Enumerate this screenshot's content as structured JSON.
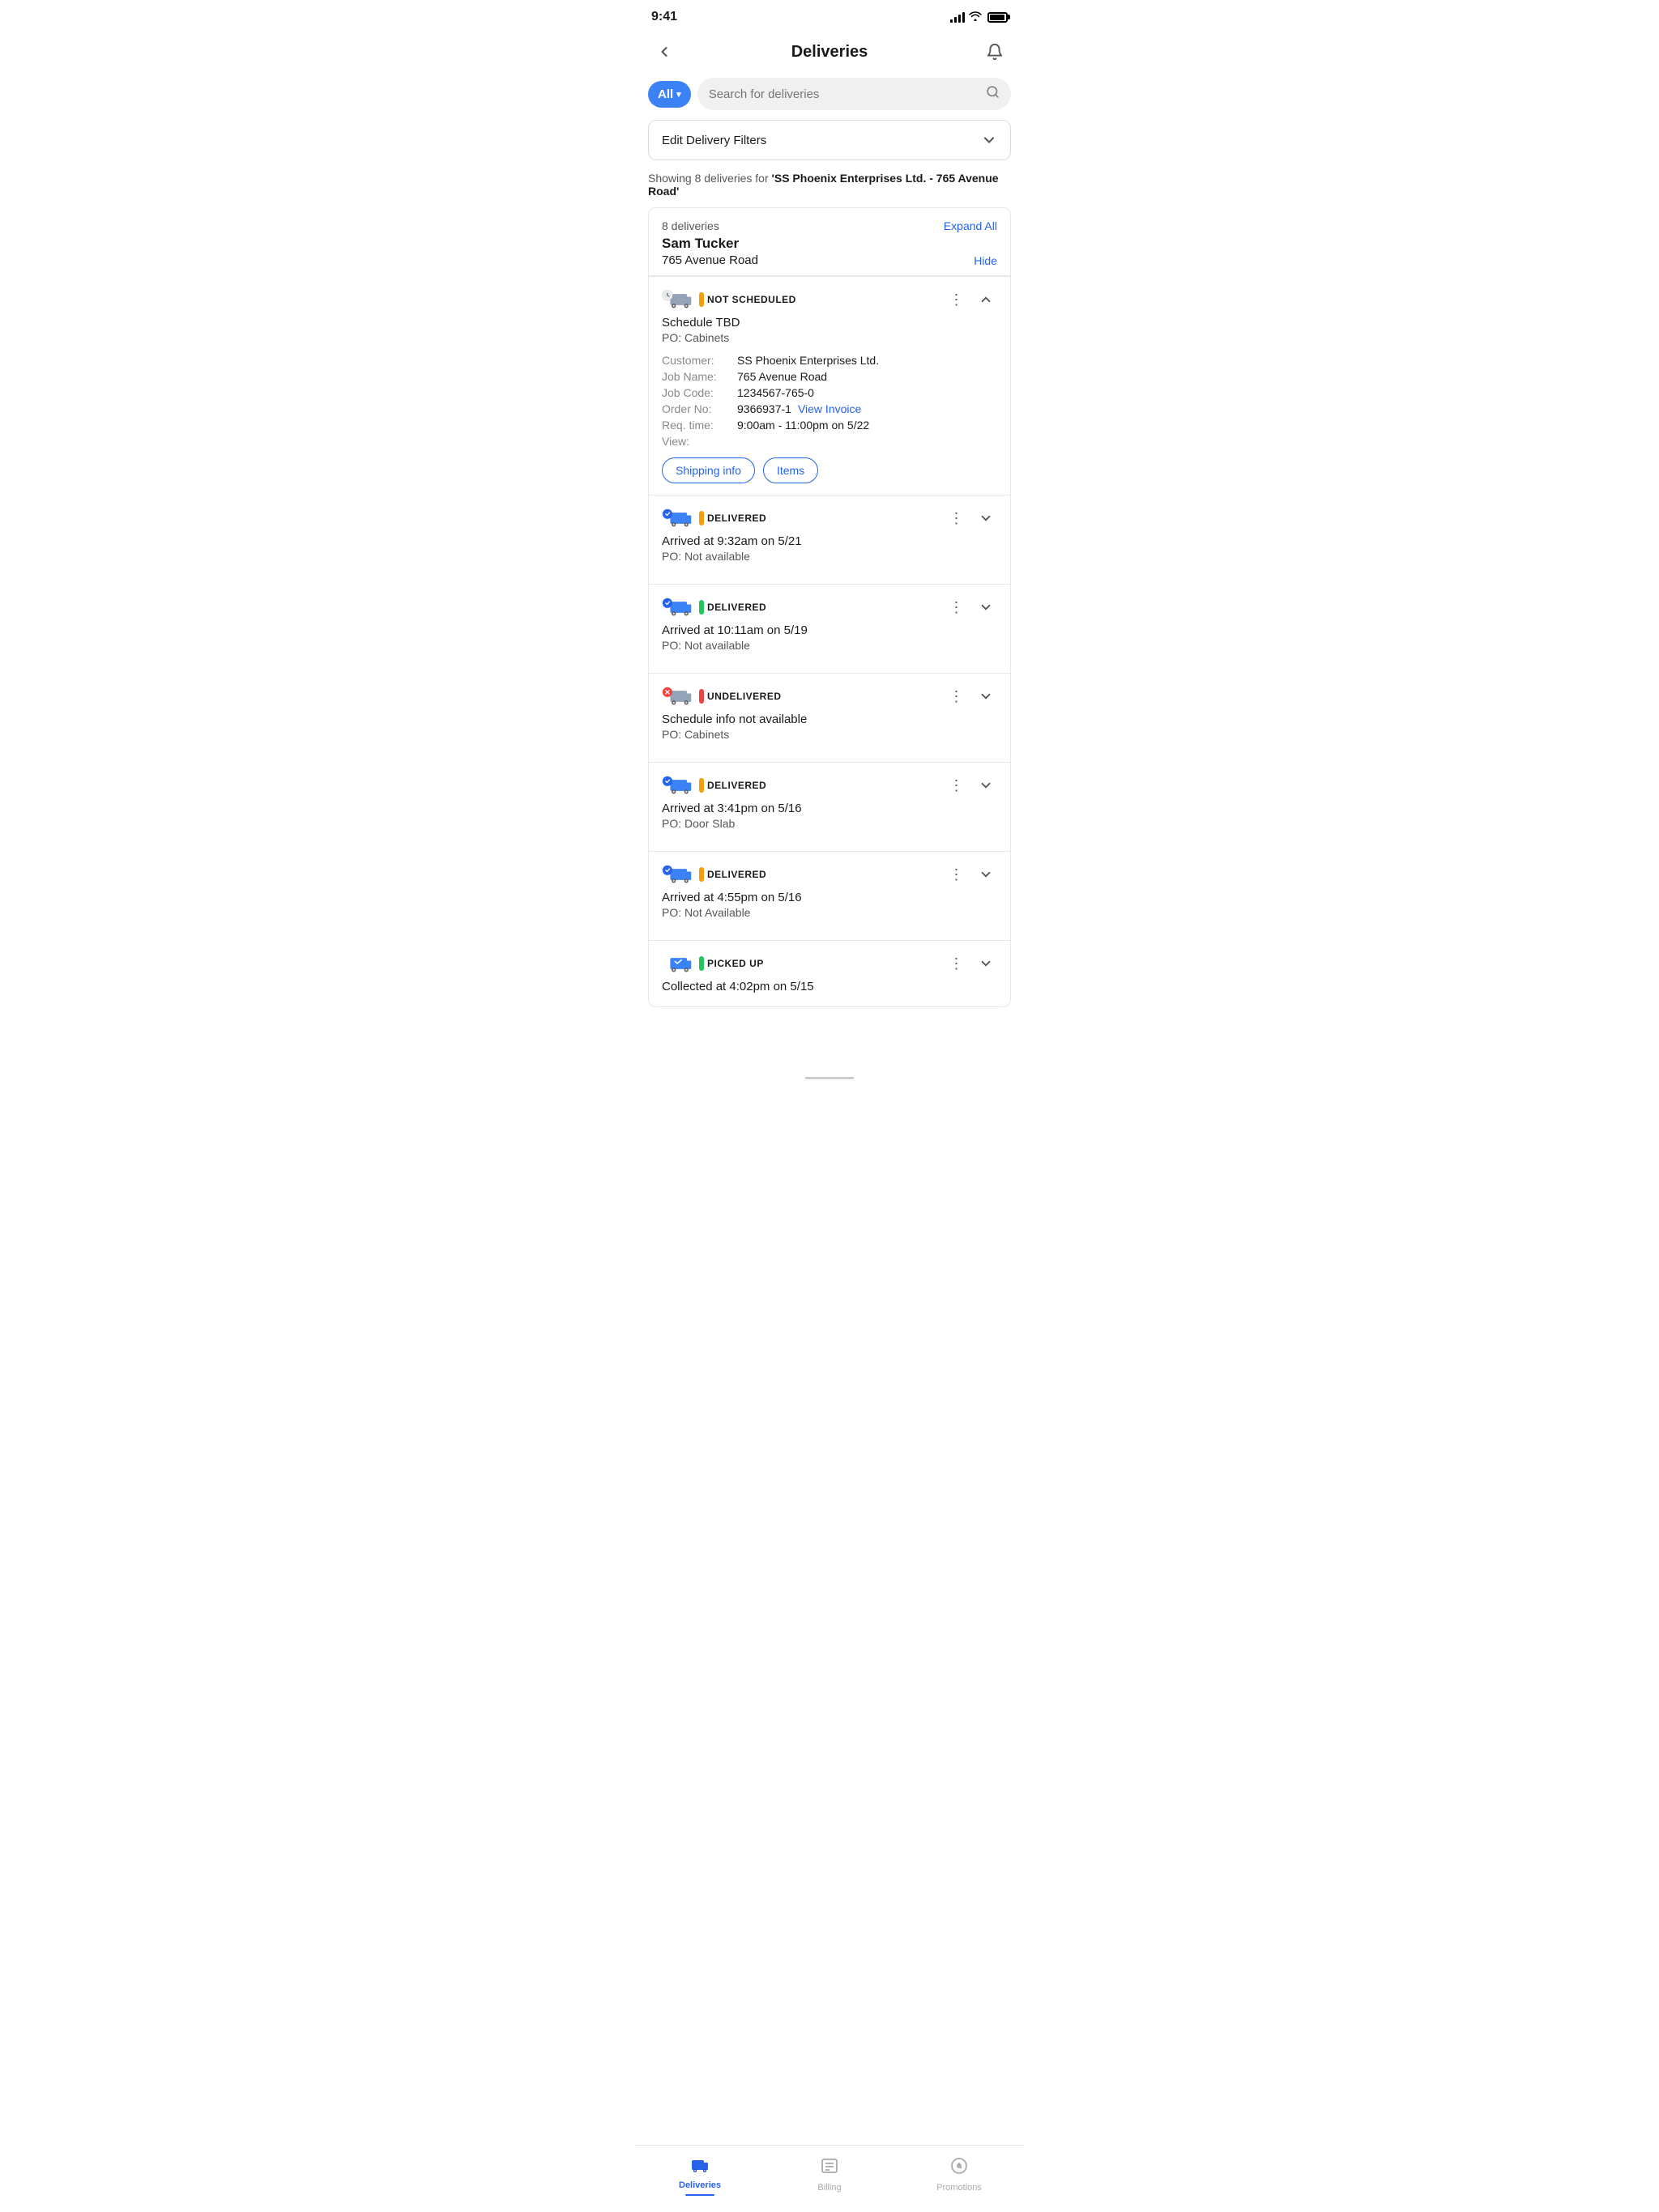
{
  "statusBar": {
    "time": "9:41",
    "battery": 85
  },
  "header": {
    "title": "Deliveries",
    "backLabel": "back",
    "bellLabel": "notifications"
  },
  "search": {
    "filterLabel": "All",
    "placeholder": "Search for deliveries"
  },
  "filterBar": {
    "label": "Edit Delivery Filters"
  },
  "resultInfo": {
    "prefix": "Showing 8 deliveries for ",
    "highlight": "'SS Phoenix Enterprises Ltd. - 765 Avenue Road'"
  },
  "group": {
    "count": "8 deliveries",
    "expandAll": "Expand All",
    "name": "Sam Tucker",
    "address": "765 Avenue Road",
    "hide": "Hide"
  },
  "deliveries": [
    {
      "id": "d1",
      "statusType": "not-scheduled",
      "statusLabel": "NOT SCHEDULED",
      "statusDotColor": "yellow",
      "title": "Schedule TBD",
      "subtitle": "PO: Cabinets",
      "expanded": true,
      "details": {
        "customer": "SS Phoenix Enterprises Ltd.",
        "jobName": "765 Avenue Road",
        "jobCode": "1234567-765-0",
        "orderNo": "9366937-1",
        "orderLink": "View Invoice",
        "reqTime": "9:00am - 11:00pm on 5/22",
        "view": ""
      },
      "buttons": [
        "Shipping info",
        "Items"
      ]
    },
    {
      "id": "d2",
      "statusType": "delivered",
      "statusLabel": "DELIVERED",
      "statusDotColor": "yellow",
      "title": "Arrived at 9:32am on 5/21",
      "subtitle": "PO: Not available",
      "expanded": false,
      "details": null,
      "buttons": []
    },
    {
      "id": "d3",
      "statusType": "delivered",
      "statusLabel": "DELIVERED",
      "statusDotColor": "green",
      "title": "Arrived at 10:11am on 5/19",
      "subtitle": "PO: Not available",
      "expanded": false,
      "details": null,
      "buttons": []
    },
    {
      "id": "d4",
      "statusType": "undelivered",
      "statusLabel": "UNDELIVERED",
      "statusDotColor": "red",
      "title": "Schedule info not available",
      "subtitle": "PO: Cabinets",
      "expanded": false,
      "details": null,
      "buttons": []
    },
    {
      "id": "d5",
      "statusType": "delivered",
      "statusLabel": "DELIVERED",
      "statusDotColor": "yellow",
      "title": "Arrived at 3:41pm on 5/16",
      "subtitle": "PO: Door Slab",
      "expanded": false,
      "details": null,
      "buttons": []
    },
    {
      "id": "d6",
      "statusType": "delivered",
      "statusLabel": "DELIVERED",
      "statusDotColor": "yellow",
      "title": "Arrived at 4:55pm on 5/16",
      "subtitle": "PO: Not Available",
      "expanded": false,
      "details": null,
      "buttons": []
    },
    {
      "id": "d7",
      "statusType": "picked-up",
      "statusLabel": "PICKED UP",
      "statusDotColor": "green",
      "title": "Collected at 4:02pm on 5/15",
      "subtitle": "",
      "expanded": false,
      "details": null,
      "buttons": []
    }
  ],
  "bottomNav": {
    "items": [
      {
        "id": "deliveries",
        "label": "Deliveries",
        "active": true
      },
      {
        "id": "billing",
        "label": "Billing",
        "active": false
      },
      {
        "id": "promotions",
        "label": "Promotions",
        "active": false
      }
    ]
  }
}
